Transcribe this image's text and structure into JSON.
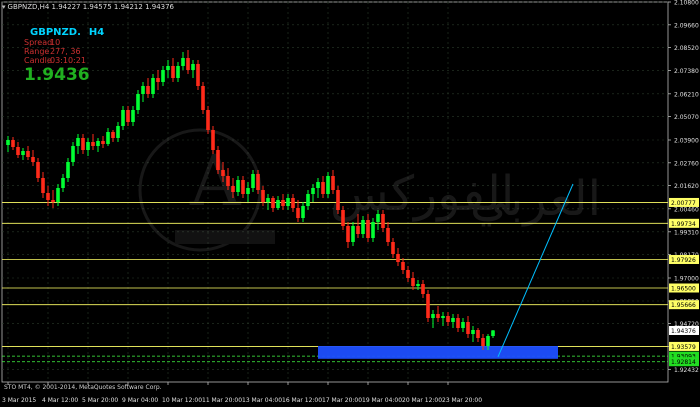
{
  "window": {
    "title": "GBPNZD,H4  1.94227 1.94575 1.94212 1.94376"
  },
  "info_panel": {
    "symbol": "GBPNZD.",
    "timeframe": "H4",
    "spread_label": "Spread",
    "spread_value": "10",
    "range_label": "Range",
    "range_value": "277, 36",
    "candle_label": "Candle",
    "candle_value": "03:10:21",
    "price": "1.9436"
  },
  "copyright": "STO MT4, © 2001-2014, MetaQuotes Software Corp.",
  "colors": {
    "background": "#000000",
    "bull_candle": "#00ff33",
    "bear_candle": "#ff2a1a",
    "grid": "#2a3a2a",
    "level_line": "#ffff66",
    "level_label_bg": "#ffff66",
    "zone": "#1e4fff",
    "trend_line": "#00bfff",
    "axis_text": "#e0e0e0"
  },
  "chart_data": {
    "type": "candlestick",
    "symbol": "GBPNZD",
    "timeframe": "H4",
    "ylim": [
      1.918,
      2.108
    ],
    "y_ticks": [
      "2.10800",
      "2.09660",
      "2.08520",
      "2.07380",
      "2.06210",
      "2.05070",
      "2.03900",
      "2.02760",
      "2.01620",
      "2.00460",
      "1.99310",
      "1.98170",
      "1.97000",
      "1.95850",
      "1.94720",
      "1.93570",
      "1.92432"
    ],
    "x_ticks": [
      "3 Mar 2015",
      "4 Mar 12:00",
      "5 Mar 20:00",
      "9 Mar 04:00",
      "10 Mar 12:00",
      "11 Mar 20:00",
      "13 Mar 04:00",
      "16 Mar 12:00",
      "17 Mar 20:00",
      "19 Mar 04:00",
      "20 Mar 12:00",
      "23 Mar 20:00"
    ],
    "x_tick_index": [
      0,
      8,
      16,
      24,
      32,
      40,
      48,
      56,
      64,
      72,
      80,
      88
    ],
    "horizontal_levels": [
      "2.00777",
      "1.99734",
      "1.97926",
      "1.96500",
      "1.95666",
      "1.93579",
      "1.93093",
      "1.92814"
    ],
    "highlighted_levels": [
      "1.93093",
      "1.92814"
    ],
    "current_price_label": "1.94376",
    "zone": {
      "from_index": 62,
      "to_index": 110,
      "top": 1.936,
      "bottom": 1.9296
    },
    "trend_line": {
      "from": {
        "index": 98,
        "price": 1.9306
      },
      "to": {
        "index": 113,
        "price": 2.017
      }
    },
    "candles": [
      {
        "o": 2.0365,
        "h": 2.041,
        "l": 2.033,
        "c": 2.039
      },
      {
        "o": 2.039,
        "h": 2.0405,
        "l": 2.034,
        "c": 2.0355
      },
      {
        "o": 2.0355,
        "h": 2.038,
        "l": 2.03,
        "c": 2.0315
      },
      {
        "o": 2.0315,
        "h": 2.035,
        "l": 2.029,
        "c": 2.0335
      },
      {
        "o": 2.0335,
        "h": 2.036,
        "l": 2.029,
        "c": 2.0305
      },
      {
        "o": 2.0305,
        "h": 2.034,
        "l": 2.026,
        "c": 2.028
      },
      {
        "o": 2.028,
        "h": 2.03,
        "l": 2.018,
        "c": 2.02
      },
      {
        "o": 2.02,
        "h": 2.023,
        "l": 2.01,
        "c": 2.0125
      },
      {
        "o": 2.0125,
        "h": 2.016,
        "l": 2.006,
        "c": 2.009
      },
      {
        "o": 2.009,
        "h": 2.014,
        "l": 2.005,
        "c": 2.008
      },
      {
        "o": 2.008,
        "h": 2.017,
        "l": 2.006,
        "c": 2.015
      },
      {
        "o": 2.015,
        "h": 2.022,
        "l": 2.013,
        "c": 2.02
      },
      {
        "o": 2.02,
        "h": 2.03,
        "l": 2.018,
        "c": 2.028
      },
      {
        "o": 2.028,
        "h": 2.038,
        "l": 2.026,
        "c": 2.036
      },
      {
        "o": 2.036,
        "h": 2.042,
        "l": 2.032,
        "c": 2.04
      },
      {
        "o": 2.04,
        "h": 2.042,
        "l": 2.032,
        "c": 2.034
      },
      {
        "o": 2.034,
        "h": 2.04,
        "l": 2.031,
        "c": 2.038
      },
      {
        "o": 2.038,
        "h": 2.042,
        "l": 2.034,
        "c": 2.036
      },
      {
        "o": 2.036,
        "h": 2.04,
        "l": 2.033,
        "c": 2.0385
      },
      {
        "o": 2.0385,
        "h": 2.041,
        "l": 2.035,
        "c": 2.037
      },
      {
        "o": 2.037,
        "h": 2.045,
        "l": 2.036,
        "c": 2.043
      },
      {
        "o": 2.043,
        "h": 2.044,
        "l": 2.038,
        "c": 2.04
      },
      {
        "o": 2.04,
        "h": 2.048,
        "l": 2.038,
        "c": 2.046
      },
      {
        "o": 2.046,
        "h": 2.056,
        "l": 2.044,
        "c": 2.054
      },
      {
        "o": 2.054,
        "h": 2.056,
        "l": 2.046,
        "c": 2.048
      },
      {
        "o": 2.048,
        "h": 2.056,
        "l": 2.046,
        "c": 2.054
      },
      {
        "o": 2.054,
        "h": 2.064,
        "l": 2.052,
        "c": 2.062
      },
      {
        "o": 2.062,
        "h": 2.068,
        "l": 2.058,
        "c": 2.066
      },
      {
        "o": 2.066,
        "h": 2.07,
        "l": 2.06,
        "c": 2.062
      },
      {
        "o": 2.062,
        "h": 2.072,
        "l": 2.06,
        "c": 2.07
      },
      {
        "o": 2.07,
        "h": 2.074,
        "l": 2.064,
        "c": 2.068
      },
      {
        "o": 2.068,
        "h": 2.076,
        "l": 2.066,
        "c": 2.074
      },
      {
        "o": 2.074,
        "h": 2.079,
        "l": 2.07,
        "c": 2.076
      },
      {
        "o": 2.076,
        "h": 2.08,
        "l": 2.068,
        "c": 2.07
      },
      {
        "o": 2.07,
        "h": 2.078,
        "l": 2.068,
        "c": 2.076
      },
      {
        "o": 2.076,
        "h": 2.083,
        "l": 2.074,
        "c": 2.08
      },
      {
        "o": 2.08,
        "h": 2.084,
        "l": 2.072,
        "c": 2.074
      },
      {
        "o": 2.074,
        "h": 2.079,
        "l": 2.07,
        "c": 2.077
      },
      {
        "o": 2.077,
        "h": 2.079,
        "l": 2.064,
        "c": 2.066
      },
      {
        "o": 2.066,
        "h": 2.068,
        "l": 2.052,
        "c": 2.054
      },
      {
        "o": 2.054,
        "h": 2.056,
        "l": 2.042,
        "c": 2.044
      },
      {
        "o": 2.044,
        "h": 2.046,
        "l": 2.032,
        "c": 2.034
      },
      {
        "o": 2.034,
        "h": 2.036,
        "l": 2.022,
        "c": 2.024
      },
      {
        "o": 2.024,
        "h": 2.028,
        "l": 2.018,
        "c": 2.021
      },
      {
        "o": 2.021,
        "h": 2.025,
        "l": 2.014,
        "c": 2.016
      },
      {
        "o": 2.016,
        "h": 2.02,
        "l": 2.01,
        "c": 2.013
      },
      {
        "o": 2.013,
        "h": 2.021,
        "l": 2.011,
        "c": 2.019
      },
      {
        "o": 2.019,
        "h": 2.021,
        "l": 2.01,
        "c": 2.012
      },
      {
        "o": 2.012,
        "h": 2.018,
        "l": 2.008,
        "c": 2.015
      },
      {
        "o": 2.015,
        "h": 2.024,
        "l": 2.013,
        "c": 2.022
      },
      {
        "o": 2.022,
        "h": 2.024,
        "l": 2.012,
        "c": 2.014
      },
      {
        "o": 2.014,
        "h": 2.016,
        "l": 2.006,
        "c": 2.008
      },
      {
        "o": 2.008,
        "h": 2.012,
        "l": 2.004,
        "c": 2.01
      },
      {
        "o": 2.01,
        "h": 2.011,
        "l": 2.003,
        "c": 2.005
      },
      {
        "o": 2.005,
        "h": 2.011,
        "l": 2.004,
        "c": 2.009
      },
      {
        "o": 2.009,
        "h": 2.012,
        "l": 2.004,
        "c": 2.006
      },
      {
        "o": 2.006,
        "h": 2.012,
        "l": 2.004,
        "c": 2.01
      },
      {
        "o": 2.01,
        "h": 2.012,
        "l": 2.003,
        "c": 2.005
      },
      {
        "o": 2.005,
        "h": 2.009,
        "l": 1.998,
        "c": 2.0
      },
      {
        "o": 2.0,
        "h": 2.008,
        "l": 1.998,
        "c": 2.006
      },
      {
        "o": 2.006,
        "h": 2.014,
        "l": 2.004,
        "c": 2.012
      },
      {
        "o": 2.012,
        "h": 2.017,
        "l": 2.008,
        "c": 2.015
      },
      {
        "o": 2.015,
        "h": 2.02,
        "l": 2.01,
        "c": 2.018
      },
      {
        "o": 2.018,
        "h": 2.021,
        "l": 2.01,
        "c": 2.012
      },
      {
        "o": 2.012,
        "h": 2.023,
        "l": 2.01,
        "c": 2.021
      },
      {
        "o": 2.021,
        "h": 2.024,
        "l": 2.012,
        "c": 2.014
      },
      {
        "o": 2.014,
        "h": 2.016,
        "l": 2.002,
        "c": 2.004
      },
      {
        "o": 2.004,
        "h": 2.006,
        "l": 1.994,
        "c": 1.996
      },
      {
        "o": 1.996,
        "h": 1.998,
        "l": 1.985,
        "c": 1.988
      },
      {
        "o": 1.988,
        "h": 1.998,
        "l": 1.986,
        "c": 1.996
      },
      {
        "o": 1.996,
        "h": 2.002,
        "l": 1.99,
        "c": 1.992
      },
      {
        "o": 1.992,
        "h": 2.001,
        "l": 1.99,
        "c": 1.999
      },
      {
        "o": 1.999,
        "h": 2.002,
        "l": 1.988,
        "c": 1.99
      },
      {
        "o": 1.99,
        "h": 2.0,
        "l": 1.988,
        "c": 1.998
      },
      {
        "o": 1.998,
        "h": 2.004,
        "l": 1.994,
        "c": 2.002
      },
      {
        "o": 2.002,
        "h": 2.004,
        "l": 1.993,
        "c": 1.995
      },
      {
        "o": 1.995,
        "h": 1.998,
        "l": 1.986,
        "c": 1.988
      },
      {
        "o": 1.988,
        "h": 1.99,
        "l": 1.98,
        "c": 1.982
      },
      {
        "o": 1.982,
        "h": 1.985,
        "l": 1.976,
        "c": 1.978
      },
      {
        "o": 1.978,
        "h": 1.98,
        "l": 1.972,
        "c": 1.974
      },
      {
        "o": 1.974,
        "h": 1.976,
        "l": 1.968,
        "c": 1.97
      },
      {
        "o": 1.97,
        "h": 1.973,
        "l": 1.964,
        "c": 1.966
      },
      {
        "o": 1.966,
        "h": 1.969,
        "l": 1.964,
        "c": 1.967
      },
      {
        "o": 1.967,
        "h": 1.969,
        "l": 1.96,
        "c": 1.962
      },
      {
        "o": 1.962,
        "h": 1.964,
        "l": 1.948,
        "c": 1.95
      },
      {
        "o": 1.95,
        "h": 1.954,
        "l": 1.945,
        "c": 1.952
      },
      {
        "o": 1.952,
        "h": 1.956,
        "l": 1.948,
        "c": 1.95
      },
      {
        "o": 1.95,
        "h": 1.953,
        "l": 1.946,
        "c": 1.951
      },
      {
        "o": 1.951,
        "h": 1.953,
        "l": 1.946,
        "c": 1.948
      },
      {
        "o": 1.948,
        "h": 1.952,
        "l": 1.945,
        "c": 1.95
      },
      {
        "o": 1.95,
        "h": 1.952,
        "l": 1.943,
        "c": 1.945
      },
      {
        "o": 1.945,
        "h": 1.95,
        "l": 1.943,
        "c": 1.948
      },
      {
        "o": 1.948,
        "h": 1.951,
        "l": 1.94,
        "c": 1.942
      },
      {
        "o": 1.942,
        "h": 1.946,
        "l": 1.938,
        "c": 1.944
      },
      {
        "o": 1.944,
        "h": 1.945,
        "l": 1.938,
        "c": 1.94
      },
      {
        "o": 1.94,
        "h": 1.942,
        "l": 1.934,
        "c": 1.936
      },
      {
        "o": 1.936,
        "h": 1.942,
        "l": 1.934,
        "c": 1.941
      },
      {
        "o": 1.941,
        "h": 1.944,
        "l": 1.94,
        "c": 1.9438
      }
    ]
  }
}
